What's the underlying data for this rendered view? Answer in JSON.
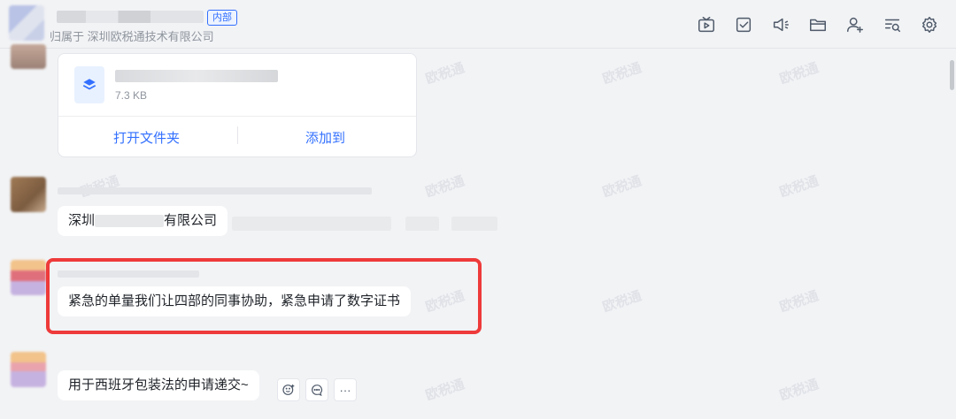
{
  "header": {
    "badge": "内部",
    "subtitle": "归属于 深圳欧税通技术有限公司",
    "tools": [
      "tv-icon",
      "task-check-icon",
      "announcement-icon",
      "folder-icon",
      "add-member-icon",
      "search-history-icon",
      "settings-icon"
    ]
  },
  "watermark": "欧税通",
  "file_card": {
    "size": "7.3 KB",
    "open_folder": "打开文件夹",
    "add_to": "添加到"
  },
  "messages": [
    {
      "prefix": "深圳",
      "suffix": "有限公司"
    },
    {
      "text": "紧急的单量我们让四部的同事协助，紧急申请了数字证书"
    },
    {
      "text": "用于西班牙包装法的申请递交~"
    }
  ],
  "actions": {
    "more": "···"
  },
  "colors": {
    "accent": "#3370ff",
    "highlight": "#ee3a3a"
  }
}
